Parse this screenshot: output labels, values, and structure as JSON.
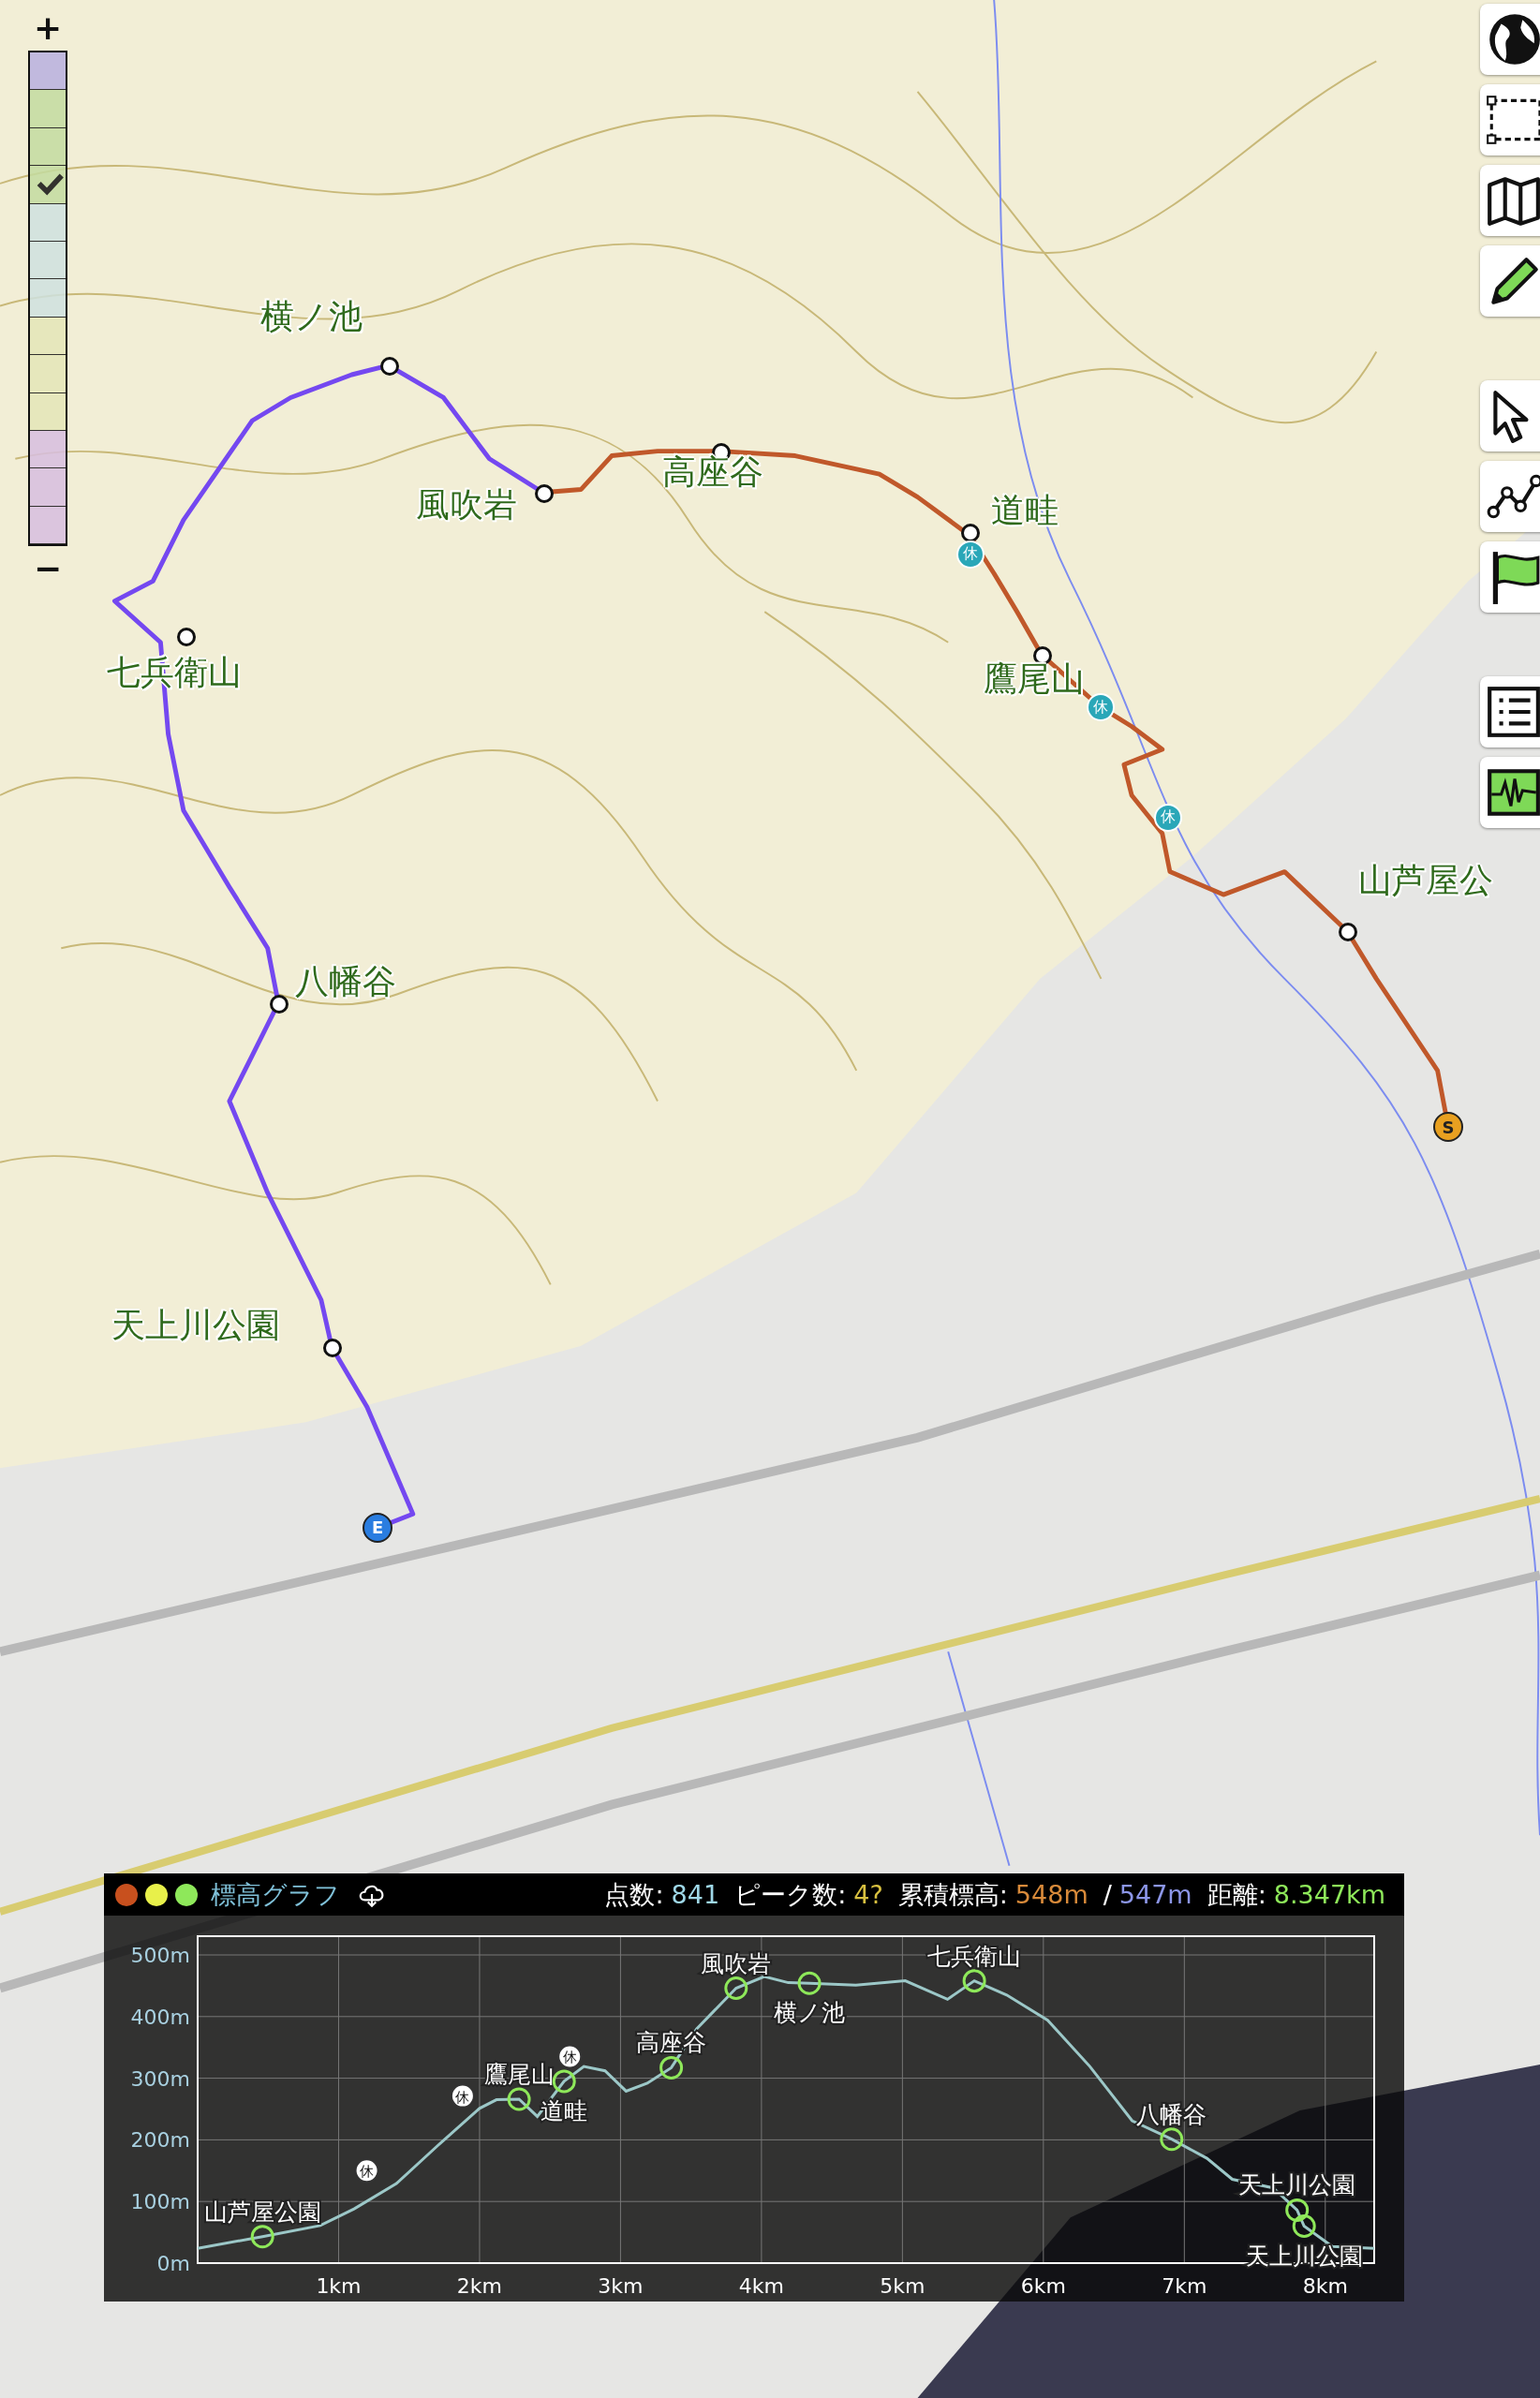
{
  "legend": {
    "zoom_in": "+",
    "zoom_out": "−",
    "swatches": [
      {
        "color": "#b9b0e0",
        "selected": false
      },
      {
        "color": "#c4dca0",
        "selected": false
      },
      {
        "color": "#c4dca0",
        "selected": false
      },
      {
        "color": "#c4dca0",
        "selected": true
      },
      {
        "color": "#cfe2e0",
        "selected": false
      },
      {
        "color": "#cfe2e0",
        "selected": false
      },
      {
        "color": "#cfe2e0",
        "selected": false
      },
      {
        "color": "#e4e6b8",
        "selected": false
      },
      {
        "color": "#e4e6b8",
        "selected": false
      },
      {
        "color": "#e4e6b8",
        "selected": false
      },
      {
        "color": "#d8bfe0",
        "selected": false
      },
      {
        "color": "#d8bfe0",
        "selected": false
      },
      {
        "color": "#d8bfe0",
        "selected": false
      }
    ]
  },
  "map_markers": [
    {
      "kind": "waypoint",
      "label": "横ノ池"
    },
    {
      "kind": "waypoint",
      "label": "風吹岩"
    },
    {
      "kind": "waypoint",
      "label": "高座谷"
    },
    {
      "kind": "waypoint",
      "label": "道畦"
    },
    {
      "kind": "waypoint",
      "label": "鷹尾山"
    },
    {
      "kind": "waypoint",
      "label": "七兵衛山"
    },
    {
      "kind": "waypoint",
      "label": "八幡谷"
    },
    {
      "kind": "waypoint",
      "label": "天上川公園"
    },
    {
      "kind": "waypoint",
      "label": "山芦屋公"
    },
    {
      "kind": "rest",
      "label": "休"
    },
    {
      "kind": "rest",
      "label": "休"
    },
    {
      "kind": "rest",
      "label": "休"
    },
    {
      "kind": "start",
      "label": "S"
    },
    {
      "kind": "end",
      "label": "E"
    }
  ],
  "elevation_panel": {
    "dots": [
      {
        "color": "#c8501e"
      },
      {
        "color": "#e8f04a"
      },
      {
        "color": "#8ee85a"
      }
    ],
    "title": "標高グラフ",
    "stats": [
      {
        "label": "点数:",
        "value": "841",
        "color": "#9fd8e8"
      },
      {
        "label": "ピーク数:",
        "value": "4?",
        "color": "#d8c040"
      },
      {
        "label": "累積標高:",
        "value": "548m",
        "color": "#d88a3a"
      },
      {
        "label": "/",
        "value": "547m",
        "color": "#8c96e8"
      },
      {
        "label": "距離:",
        "value": "8.347km",
        "color": "#8ee85a"
      }
    ],
    "chart_data": {
      "type": "line",
      "xlim": [
        0,
        8.347
      ],
      "ylim": [
        0,
        500
      ],
      "xticks": [
        {
          "value": 1,
          "label": "1km"
        },
        {
          "value": 2,
          "label": "2km"
        },
        {
          "value": 3,
          "label": "3km"
        },
        {
          "value": 4,
          "label": "4km"
        },
        {
          "value": 5,
          "label": "5km"
        },
        {
          "value": 6,
          "label": "6km"
        },
        {
          "value": 7,
          "label": "7km"
        },
        {
          "value": 8,
          "label": "8km"
        }
      ],
      "yticks": [
        {
          "value": 0,
          "label": "0m"
        },
        {
          "value": 100,
          "label": "100m"
        },
        {
          "value": 200,
          "label": "200m"
        },
        {
          "value": 300,
          "label": "300m"
        },
        {
          "value": 400,
          "label": "400m"
        },
        {
          "value": 500,
          "label": "500m"
        }
      ],
      "x": [
        0,
        0.46,
        0.87,
        1.11,
        1.41,
        1.7,
        2.0,
        2.12,
        2.28,
        2.41,
        2.6,
        2.74,
        2.89,
        3.04,
        3.19,
        3.36,
        3.54,
        3.82,
        4.02,
        4.19,
        4.34,
        4.67,
        5.02,
        5.32,
        5.51,
        5.74,
        6.03,
        6.33,
        6.63,
        6.91,
        7.16,
        7.34,
        7.63,
        7.8,
        7.85,
        8.05,
        8.347
      ],
      "grid": true,
      "series": [
        {
          "color": "#9cc8c8",
          "values": [
            24,
            43,
            61,
            88,
            129,
            190,
            251,
            265,
            266,
            238,
            295,
            319,
            312,
            279,
            292,
            317,
            380,
            446,
            465,
            455,
            454,
            451,
            458,
            428,
            458,
            435,
            394,
            319,
            231,
            201,
            170,
            136,
            122,
            86,
            60,
            27,
            24
          ]
        }
      ],
      "annotations": [
        {
          "text": "山芦屋公園",
          "x": 0.46,
          "y": 43
        },
        {
          "text": "鷹尾山",
          "x": 2.28,
          "y": 266
        },
        {
          "text": "道畦",
          "x": 2.6,
          "y": 295
        },
        {
          "text": "高座谷",
          "x": 3.36,
          "y": 317
        },
        {
          "text": "風吹岩",
          "x": 3.82,
          "y": 446
        },
        {
          "text": "横ノ池",
          "x": 4.34,
          "y": 454
        },
        {
          "text": "七兵衛山",
          "x": 5.51,
          "y": 458
        },
        {
          "text": "八幡谷",
          "x": 6.91,
          "y": 201
        },
        {
          "text": "天上川公園",
          "x": 7.8,
          "y": 86
        },
        {
          "text": "天上川公園",
          "x": 7.85,
          "y": 60
        }
      ]
    },
    "rest_markers": [
      {
        "label": "休"
      },
      {
        "label": "休"
      },
      {
        "label": "休"
      }
    ]
  }
}
